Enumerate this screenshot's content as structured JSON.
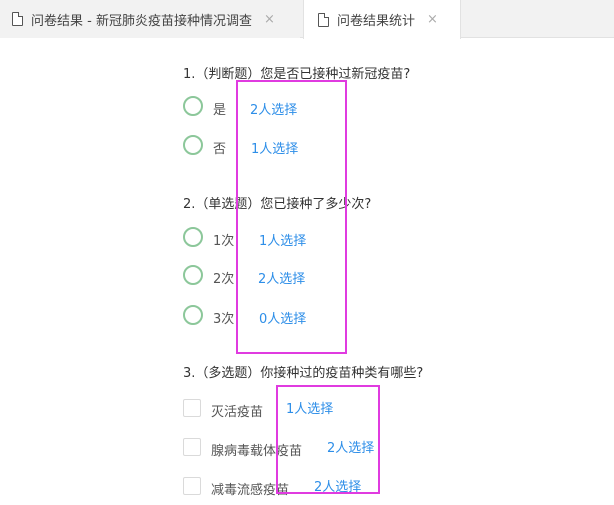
{
  "tabs": [
    {
      "label": "问卷结果 - 新冠肺炎疫苗接种情况调查",
      "icon": "document-icon",
      "close": "×"
    },
    {
      "label": "问卷结果统计",
      "icon": "document-icon",
      "close": "×",
      "active": true
    }
  ],
  "questions": [
    {
      "title": "1.（判断题）您是否已接种过新冠疫苗?",
      "type": "radio",
      "options": [
        {
          "label": "是",
          "count": "2人选择"
        },
        {
          "label": "否",
          "count": "1人选择"
        }
      ]
    },
    {
      "title": "2.（单选题）您已接种了多少次?",
      "type": "radio",
      "options": [
        {
          "label": "1次",
          "count": "1人选择"
        },
        {
          "label": "2次",
          "count": "2人选择"
        },
        {
          "label": "3次",
          "count": "0人选择"
        }
      ]
    },
    {
      "title": "3.（多选题）你接种过的疫苗种类有哪些?",
      "type": "checkbox",
      "options": [
        {
          "label": "灭活疫苗",
          "count": "1人选择"
        },
        {
          "label": "腺病毒载体疫苗",
          "count": "2人选择"
        },
        {
          "label": "减毒流感疫苗",
          "count": "2人选择"
        }
      ]
    }
  ],
  "colors": {
    "count_text": "#2d8ee8",
    "radio_border": "#8cc79a",
    "highlight": "#e03be0"
  }
}
